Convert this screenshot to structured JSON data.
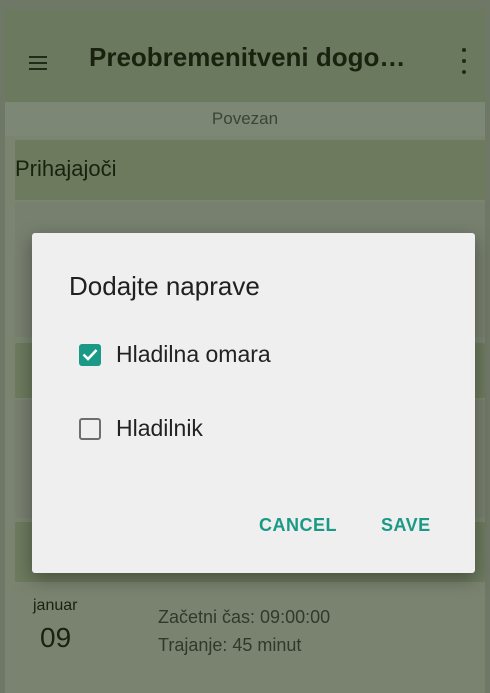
{
  "appbar": {
    "title": "Preobremenitveni dogo…",
    "menu_icon": "hamburger-menu-icon",
    "more_icon": "more-vert-icon"
  },
  "status": "Povezan",
  "sections": [
    {
      "title": "Prihajajoči"
    }
  ],
  "event": {
    "month": "januar",
    "day": "09",
    "start": "Začetni čas: 09:00:00",
    "duration": "Trajanje: 45 minut"
  },
  "dialog": {
    "title": "Dodajte naprave",
    "options": [
      {
        "label": "Hladilna omara",
        "checked": true
      },
      {
        "label": "Hladilnik",
        "checked": false
      }
    ],
    "cancel_label": "CANCEL",
    "save_label": "SAVE"
  },
  "colors": {
    "accent": "#1a9a86",
    "appbar": "#6b7a5e",
    "dialog": "#efefef"
  }
}
